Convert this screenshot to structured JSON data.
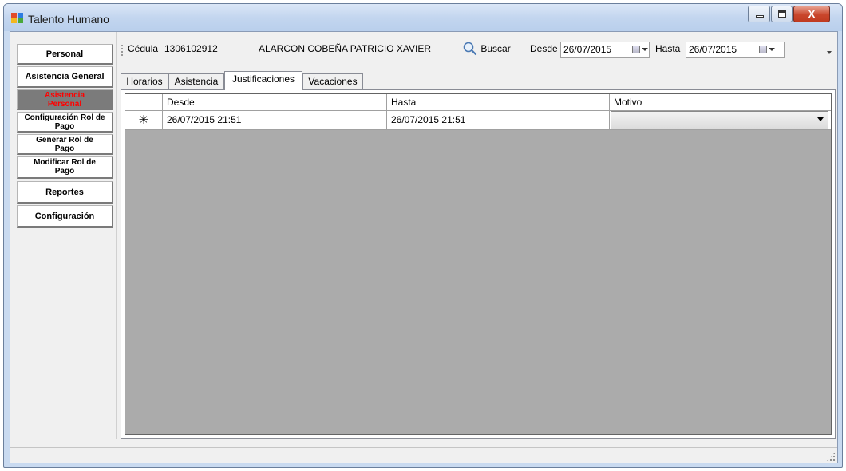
{
  "window": {
    "title": "Talento Humano",
    "close_glyph": "X",
    "icon": "app-window-icon"
  },
  "nav": {
    "items": [
      {
        "label": "Personal"
      },
      {
        "label": "Asistencia General"
      },
      {
        "label": "Asistencia Personal",
        "active": true
      },
      {
        "label": "Configuración Rol de Pago"
      },
      {
        "label": "Generar Rol de Pago"
      },
      {
        "label": "Modificar Rol de Pago"
      },
      {
        "label": "Reportes"
      },
      {
        "label": "Configuración"
      }
    ]
  },
  "toolbar": {
    "cedula_label": "Cédula",
    "cedula_value": "1306102912",
    "employee_name": "ALARCON COBEÑA PATRICIO XAVIER",
    "search_label": "Buscar",
    "desde_label": "Desde",
    "desde_value": "26/07/2015",
    "hasta_label": "Hasta",
    "hasta_value": "26/07/2015"
  },
  "tabs": [
    {
      "label": "Horarios"
    },
    {
      "label": "Asistencia"
    },
    {
      "label": "Justificaciones",
      "selected": true
    },
    {
      "label": "Vacaciones"
    }
  ],
  "grid": {
    "columns": [
      "Desde",
      "Hasta",
      "Motivo"
    ],
    "new_row_marker": "✳",
    "rows": [
      {
        "desde": "26/07/2015 21:51",
        "hasta": "26/07/2015 21:51",
        "motivo": ""
      }
    ]
  },
  "colors": {
    "active_nav_bg": "#7b7b7b",
    "active_nav_text": "#ff0000",
    "grid_background": "#ababab",
    "titlebar": "#c3d6ef",
    "close_button": "#c9462c"
  }
}
